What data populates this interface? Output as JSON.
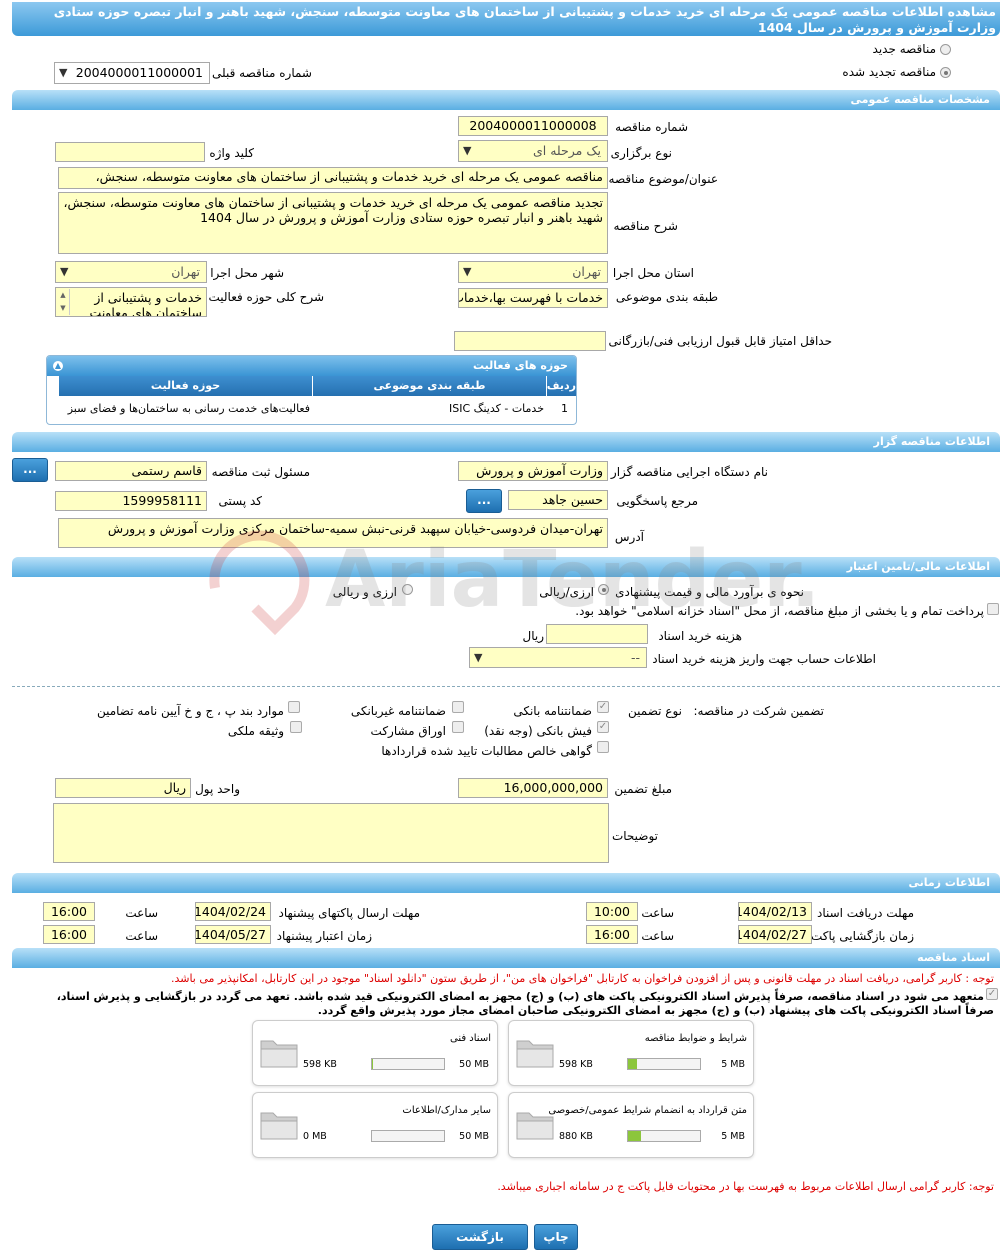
{
  "title": "مشاهده اطلاعات مناقصه عمومی یک مرحله ای خرید خدمات و پشتیبانی از ساختمان های معاونت متوسطه، سنجش، شهید باهنر و انبار تبصره حوزه ستادی وزارت آموزش و پرورش در سال 1404",
  "top": {
    "new_label": "مناقصه جدید",
    "renewed_label": "مناقصه تجدید شده",
    "prev_label": "شماره مناقصه قبلی",
    "prev_value": "2004000011000001"
  },
  "sections": {
    "general": "مشخصات مناقصه عمومی",
    "organizer": "اطلاعات مناقصه گزار",
    "financial": "اطلاعات مالی/تامین اعتبار",
    "time": "اطلاعات زمانی",
    "docs": "اسناد مناقصه"
  },
  "general": {
    "number_label": "شماره مناقصه",
    "number": "2004000011000008",
    "type_label": "نوع برگزاری",
    "type": "یک مرحله ای",
    "keyword_label": "کلید واژه",
    "keyword": "",
    "subject_label": "عنوان/موضوع مناقصه",
    "subject": "مناقصه عمومی یک مرحله ای خرید خدمات و پشتیبانی از ساختمان های معاونت متوسطه، سنجش،",
    "desc_label": "شرح مناقصه",
    "desc": "تجدید مناقصه عمومی یک مرحله ای خرید خدمات و پشتیبانی از ساختمان های معاونت متوسطه، سنجش، شهید باهنر و انبار تبصره حوزه ستادی وزارت آموزش و پرورش در سال 1404",
    "province_label": "استان محل اجرا",
    "province": "تهران",
    "city_label": "شهر محل اجرا",
    "city": "تهران",
    "category_label": "طبقه بندی موضوعی",
    "category": "خدمات با فهرست بها،خدمات",
    "scope_label": "شرح کلی حوزه فعالیت",
    "scope": "خدمات و پشتیبانی از ساختمان های معاونت",
    "minscore_label": "حداقل امتیاز قابل قبول ارزیابی فنی/بازرگانی",
    "minscore": ""
  },
  "activity_table": {
    "title": "حوزه های فعالیت",
    "headers": [
      "ردیف",
      "طبقه بندی موضوعی",
      "حوزه فعالیت"
    ],
    "rows": [
      [
        "1",
        "خدمات - کدینگ ISIC",
        "فعالیت‌های خدمت رسانی به ساختمان‌ها و فضای سبز"
      ]
    ]
  },
  "organizer": {
    "agency_label": "نام دستگاه اجرایی مناقصه گزار",
    "agency": "وزارت آموزش و پرورش",
    "registrar_label": "مسئول ثبت مناقصه",
    "registrar": "قاسم رستمی",
    "ref_label": "مرجع پاسخگویی",
    "ref": "حسین جاهد",
    "postal_label": "کد پستی",
    "postal": "1599958111",
    "address_label": "آدرس",
    "address": "تهران-میدان فردوسی-خیابان سپهبد قرنی-نبش سمیه-ساختمان مرکزی وزارت آموزش و پرورش",
    "dots": "..."
  },
  "financial": {
    "estimate_label": "نحوه ی برآورد مالی و قیمت پیشنهادی",
    "opt1": "ارزی/ریالی",
    "opt2": "ارزی و ریالی",
    "treasury": "پرداخت تمام و یا بخشی از مبلغ مناقصه، از محل \"اسناد خزانه اسلامی\" خواهد بود.",
    "doccost_label": "هزینه خرید اسناد",
    "doccost": "",
    "rial": "ریال",
    "account_label": "اطلاعات حساب جهت واریز هزینه خرید اسناد",
    "account": "--"
  },
  "guarantee": {
    "label": "تضمین شرکت در مناقصه:",
    "type_label": "نوع تضمین",
    "opts": [
      "ضمانتنامه بانکی",
      "ضمانتنامه غیربانکی",
      "موارد بند پ ، ج و خ آیین نامه تضامین",
      "فیش بانکی (وجه نقد)",
      "اوراق مشارکت",
      "وثیقه ملکی",
      "گواهی خالص مطالبات تایید شده قراردادها"
    ],
    "amount_label": "مبلغ تضمین",
    "amount": "16,000,000,000",
    "currency_label": "واحد پول",
    "currency": "ریال",
    "notes_label": "توضیحات",
    "notes": ""
  },
  "time": {
    "receive_label": "مهلت دریافت اسناد",
    "receive_date": "1404/02/13",
    "send_label": "مهلت ارسال پاکتهای پیشنهاد",
    "send_date": "1404/02/24",
    "open_label": "زمان بازگشایی پاکت ها",
    "open_date": "1404/02/27",
    "valid_label": "زمان اعتبار پیشنهاد",
    "valid_date": "1404/05/27",
    "hour_label": "ساعت",
    "t1": "16:00",
    "t2": "16:00",
    "t3": "10:00",
    "t4": "16:00"
  },
  "docs": {
    "note1": "توجه : کاربر گرامی، دریافت اسناد در مهلت قانونی و پس از افزودن فراخوان به کارتابل \"فراخوان های من\"، از طریق ستون \"دانلود اسناد\" موجود در این کارتابل، امکانپذیر می باشد.",
    "commit1": "متعهد می شود در اسناد مناقصه، صرفاً پذیرش اسناد الکترونیکی پاکت های (ب) و (ج) مجهز به امضای الکترونیکی قید شده باشد. تعهد می گردد در بازگشایی و پذیرش اسناد،",
    "commit2": "صرفاً اسناد الکترونیکی پاکت های پیشنهاد (ب) و (ج) مجهز به امضای الکترونیکی صاحبان امضای مجاز مورد پذیرش واقع گردد.",
    "files": [
      {
        "name": "شرایط و ضوابط مناقصه",
        "size": "598 KB",
        "max": "5 MB",
        "fill": 0.12
      },
      {
        "name": "اسناد فنی",
        "size": "598 KB",
        "max": "50 MB",
        "fill": 0.02
      },
      {
        "name": "متن قرارداد به انضمام شرایط عمومی/خصوصی",
        "size": "880 KB",
        "max": "5 MB",
        "fill": 0.18
      },
      {
        "name": "سایر مدارک/اطلاعات",
        "size": "0 MB",
        "max": "50 MB",
        "fill": 0
      }
    ],
    "note2": "توجه: کاربر گرامی ارسال اطلاعات مربوط به فهرست بها در محتویات فایل پاکت ج در سامانه اجباری میباشد."
  },
  "buttons": {
    "print": "چاپ",
    "back": "بازگشت"
  },
  "watermark": "AriaTender.neT"
}
